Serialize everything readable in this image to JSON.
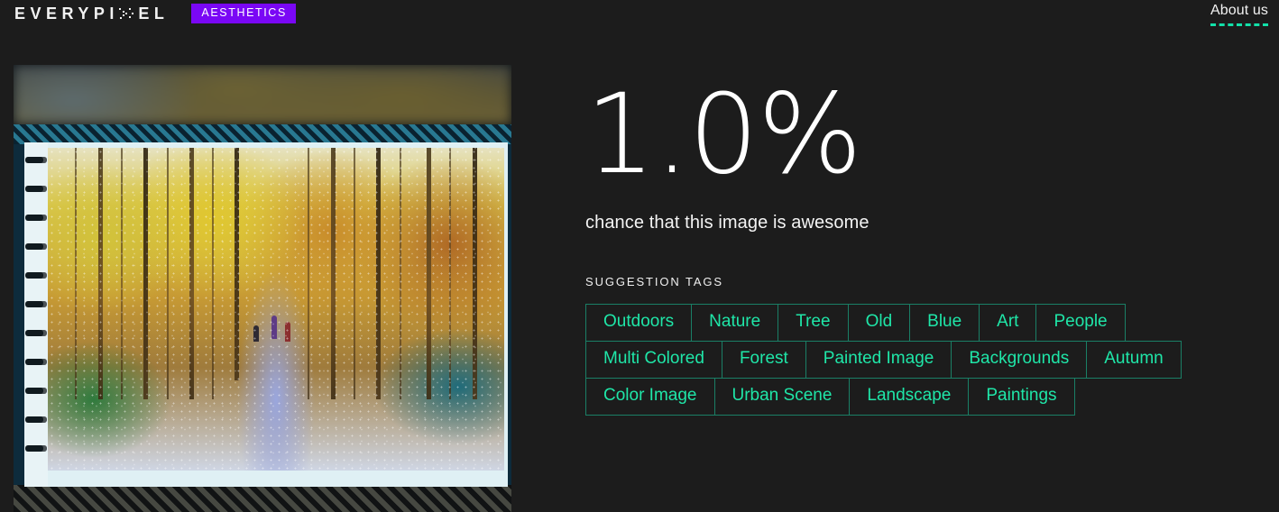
{
  "header": {
    "logo_before": "EVERYPI",
    "logo_icon": "pixel-x-icon",
    "logo_after": "EL",
    "badge_label": "AESTHETICS",
    "about_label": "About us",
    "accent_purple": "#7a07f5",
    "accent_teal": "#12e0a8"
  },
  "preview": {
    "alt": "watercolour painting of an autumn forest path in a spiral sketchbook"
  },
  "result": {
    "score": "1.0%",
    "caption": "chance that this image is awesome"
  },
  "tags_section": {
    "heading": "SUGGESTION TAGS",
    "tags": [
      "Outdoors",
      "Nature",
      "Tree",
      "Old",
      "Blue",
      "Art",
      "People",
      "Multi Colored",
      "Forest",
      "Painted Image",
      "Backgrounds",
      "Autumn",
      "Color Image",
      "Urban Scene",
      "Landscape",
      "Paintings"
    ],
    "tag_text_color": "#1fe6a8",
    "tag_border_color": "#1a7f66"
  }
}
